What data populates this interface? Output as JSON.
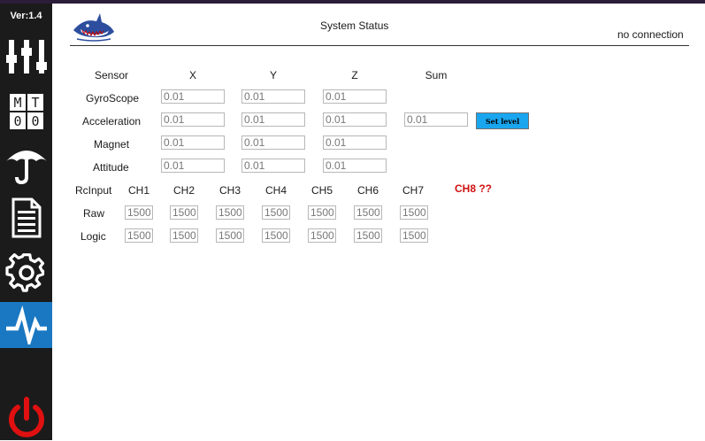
{
  "app": {
    "version": "Ver:1.4"
  },
  "nav": {
    "items": [
      {
        "name": "sliders-icon"
      },
      {
        "name": "mt00-icon",
        "text": [
          "M",
          "T",
          "0",
          "0"
        ]
      },
      {
        "name": "umbrella-icon"
      },
      {
        "name": "document-icon"
      },
      {
        "name": "gear-icon"
      },
      {
        "name": "pulse-icon",
        "active": true
      },
      {
        "name": "power-icon"
      }
    ]
  },
  "header": {
    "title": "System Status",
    "connection": "no connection"
  },
  "sensor": {
    "columns": [
      "Sensor",
      "X",
      "Y",
      "Z",
      "Sum"
    ],
    "rows": [
      {
        "label": "GyroScope",
        "x": "0.01",
        "y": "0.01",
        "z": "0.01"
      },
      {
        "label": "Acceleration",
        "x": "0.01",
        "y": "0.01",
        "z": "0.01",
        "sum": "0.01"
      },
      {
        "label": "Magnet",
        "x": "0.01",
        "y": "0.01",
        "z": "0.01"
      },
      {
        "label": "Attitude",
        "x": "0.01",
        "y": "0.01",
        "z": "0.01"
      }
    ],
    "set_level_label": "Set level"
  },
  "rc": {
    "header": "RcInput",
    "channels": [
      "CH1",
      "CH2",
      "CH3",
      "CH4",
      "CH5",
      "CH6",
      "CH7"
    ],
    "ch8_label": "CH8 ??",
    "raw_label": "Raw",
    "logic_label": "Logic",
    "raw": [
      "1500",
      "1500",
      "1500",
      "1500",
      "1500",
      "1500",
      "1500"
    ],
    "logic": [
      "1500",
      "1500",
      "1500",
      "1500",
      "1500",
      "1500",
      "1500"
    ]
  },
  "colors": {
    "sidebar": "#1b1b1b",
    "active": "#1a78c2",
    "button": "#1aa6ef",
    "warning": "#d01010",
    "power": "#e01010"
  }
}
